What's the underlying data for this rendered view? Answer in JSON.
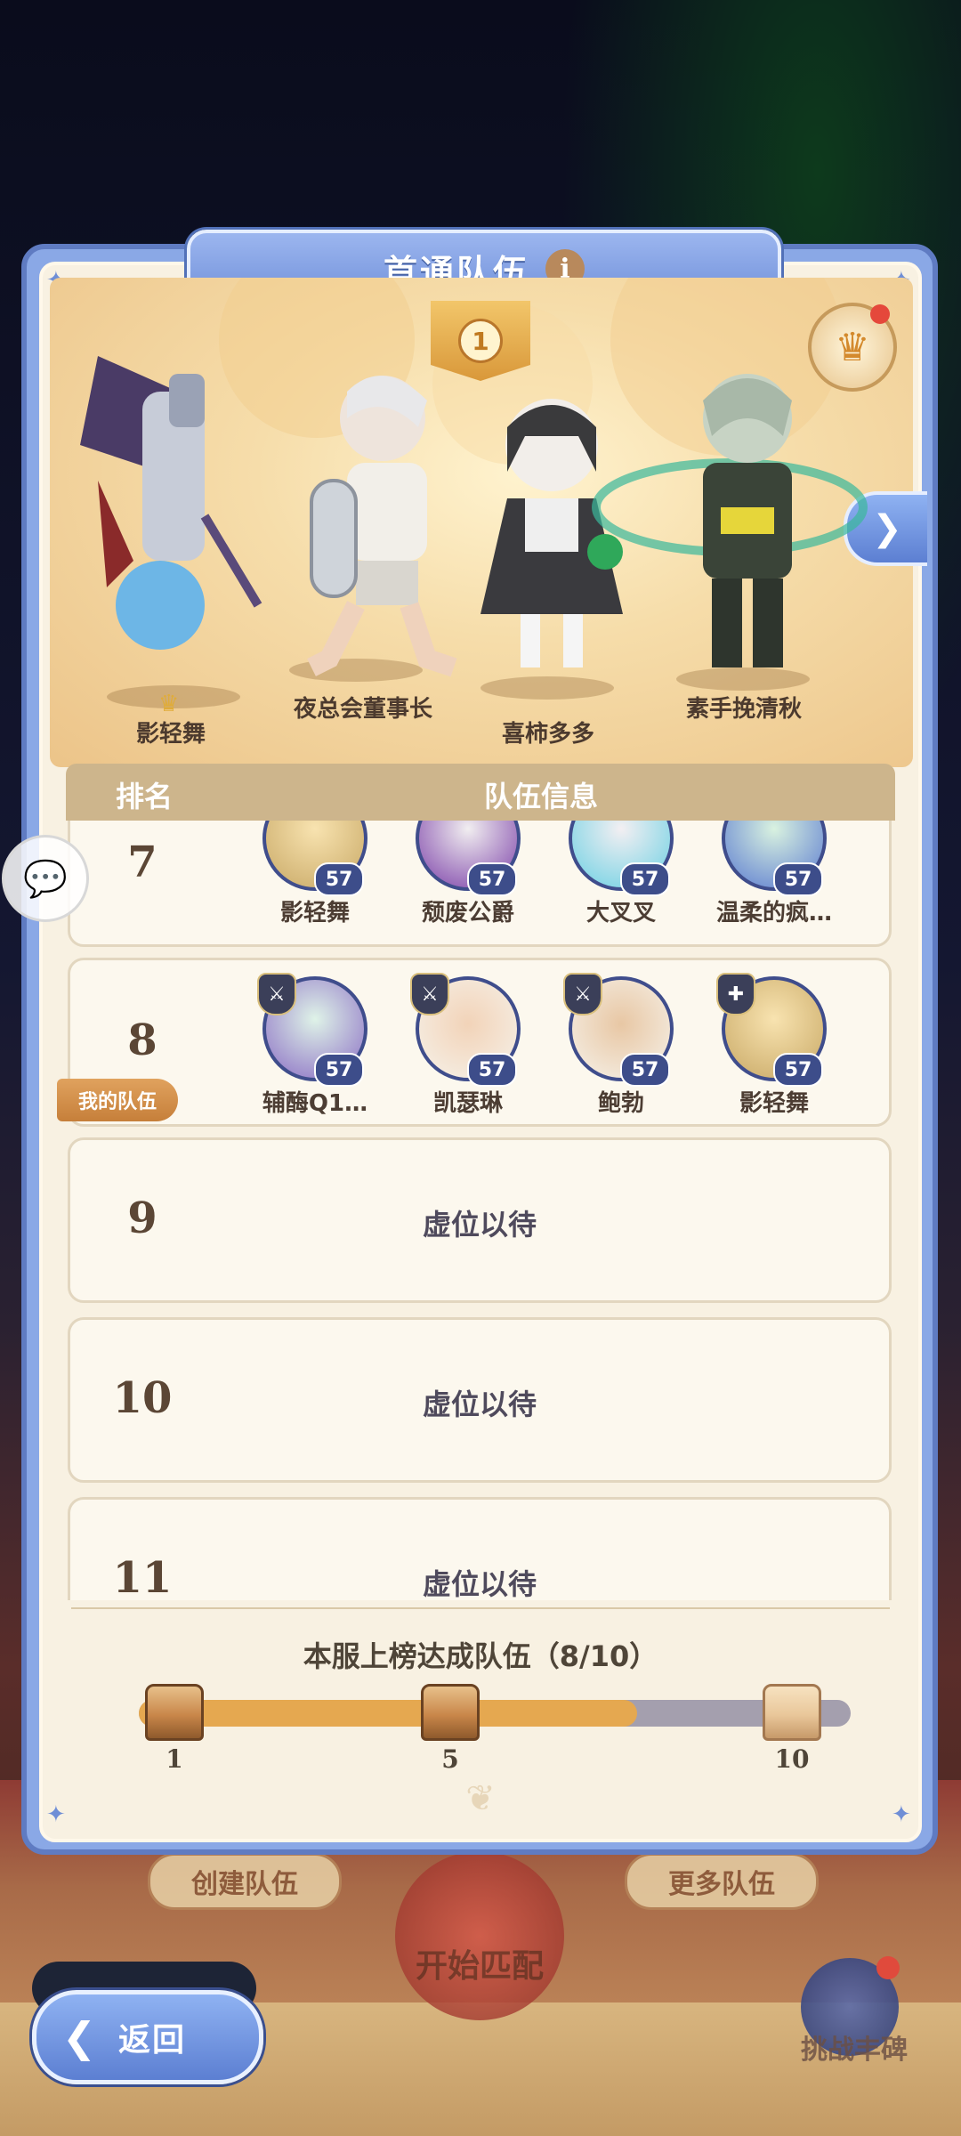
{
  "title": "首通队伍",
  "info_icon": "i",
  "rank_badge": "1",
  "header": {
    "rank": "排名",
    "team_info": "队伍信息"
  },
  "heroes": [
    {
      "name": "影轻舞"
    },
    {
      "name": "夜总会董事长"
    },
    {
      "name": "喜柿多多"
    },
    {
      "name": "素手挽清秋"
    }
  ],
  "teams": [
    {
      "rank": "7",
      "members": [
        {
          "name": "影轻舞",
          "level": "57"
        },
        {
          "name": "颓废公爵",
          "level": "57"
        },
        {
          "name": "大叉叉",
          "level": "57"
        },
        {
          "name": "温柔的疯…",
          "level": "57"
        }
      ]
    },
    {
      "rank": "8",
      "my_team": "我的队伍",
      "members": [
        {
          "name": "辅酶Q1…",
          "level": "57"
        },
        {
          "name": "凯瑟琳",
          "level": "57"
        },
        {
          "name": "鲍勃",
          "level": "57"
        },
        {
          "name": "影轻舞",
          "level": "57"
        }
      ]
    },
    {
      "rank": "9",
      "empty_text": "虚位以待"
    },
    {
      "rank": "10",
      "empty_text": "虚位以待"
    },
    {
      "rank": "11",
      "empty_text": "虚位以待"
    }
  ],
  "progress": {
    "title": "本服上榜达成队伍（8/10）",
    "current": 8,
    "max": 10,
    "milestones": [
      "1",
      "5",
      "10"
    ]
  },
  "background": {
    "create_team": "创建队伍",
    "more_teams": "更多队伍",
    "start_match": "开始匹配",
    "challenge": "挑战丰碑"
  },
  "back_button": "返回",
  "colors": {
    "panel_blue": "#8aa8e6",
    "accent_gold": "#e5a850",
    "level_badge": "#3d4d8a"
  },
  "icons": [
    "info-icon",
    "crown-icon",
    "chevron-right-icon",
    "chat-icon",
    "chest-icon",
    "back-arrow-icon",
    "sword-icon",
    "cross-icon"
  ]
}
